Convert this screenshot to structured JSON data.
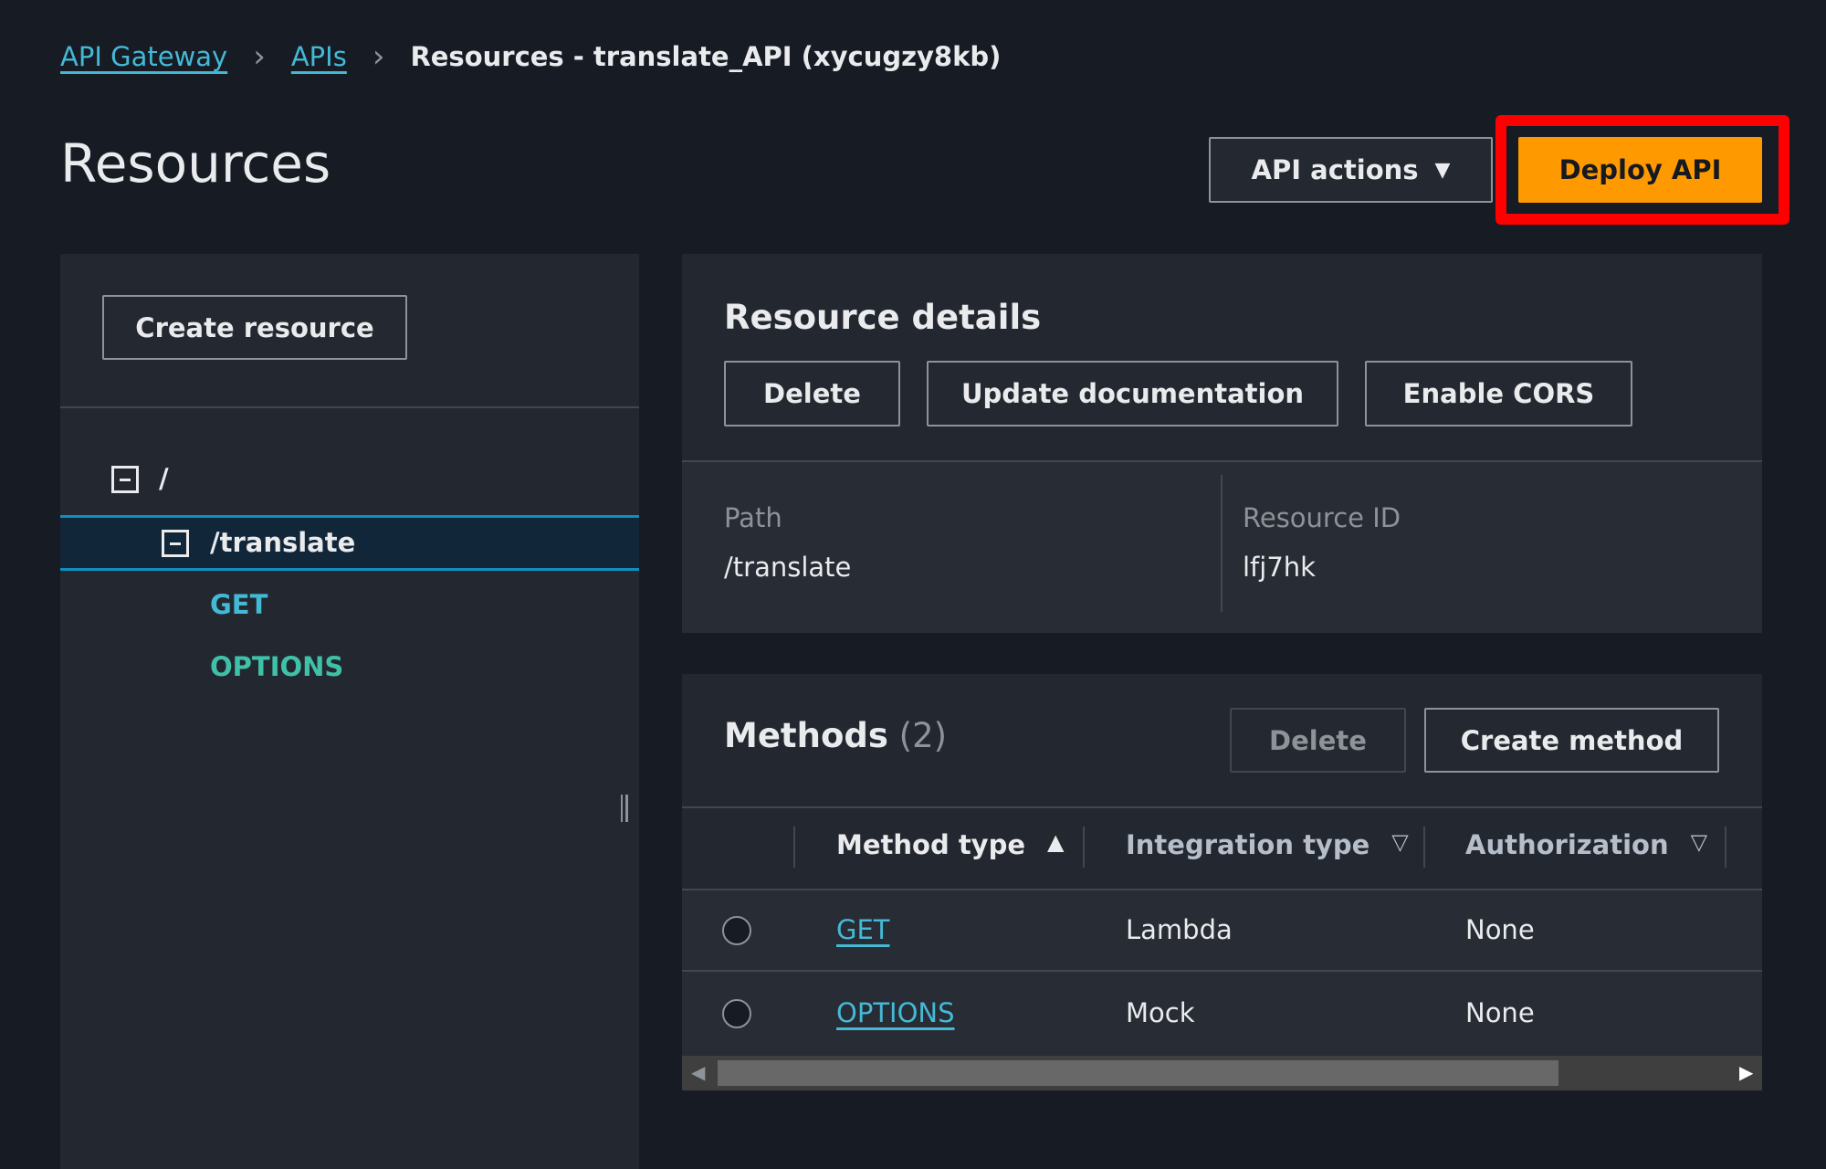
{
  "breadcrumb": {
    "items": [
      "API Gateway",
      "APIs"
    ],
    "current": "Resources - translate_API (xycugzy8kb)"
  },
  "page": {
    "title": "Resources",
    "api_actions": "API actions",
    "deploy": "Deploy API"
  },
  "left": {
    "create_resource": "Create resource",
    "tree": [
      {
        "label": "/"
      },
      {
        "label": "/translate",
        "selected": true
      },
      {
        "label": "GET",
        "color": "#44b9d6"
      },
      {
        "label": "OPTIONS",
        "color": "#3fc0a8"
      }
    ]
  },
  "details": {
    "title": "Resource details",
    "delete": "Delete",
    "update_doc": "Update documentation",
    "enable_cors": "Enable CORS",
    "path_label": "Path",
    "path_value": "/translate",
    "id_label": "Resource ID",
    "id_value": "lfj7hk"
  },
  "methods": {
    "title": "Methods",
    "count": "(2)",
    "delete": "Delete",
    "create": "Create method",
    "columns": [
      "Method type",
      "Integration type",
      "Authorization"
    ],
    "rows": [
      {
        "method": "GET",
        "integration": "Lambda",
        "authorization": "None"
      },
      {
        "method": "OPTIONS",
        "integration": "Mock",
        "authorization": "None"
      }
    ]
  },
  "colors": {
    "accent": "#ff9900",
    "link": "#44b9d6",
    "highlight": "#ff0000"
  }
}
